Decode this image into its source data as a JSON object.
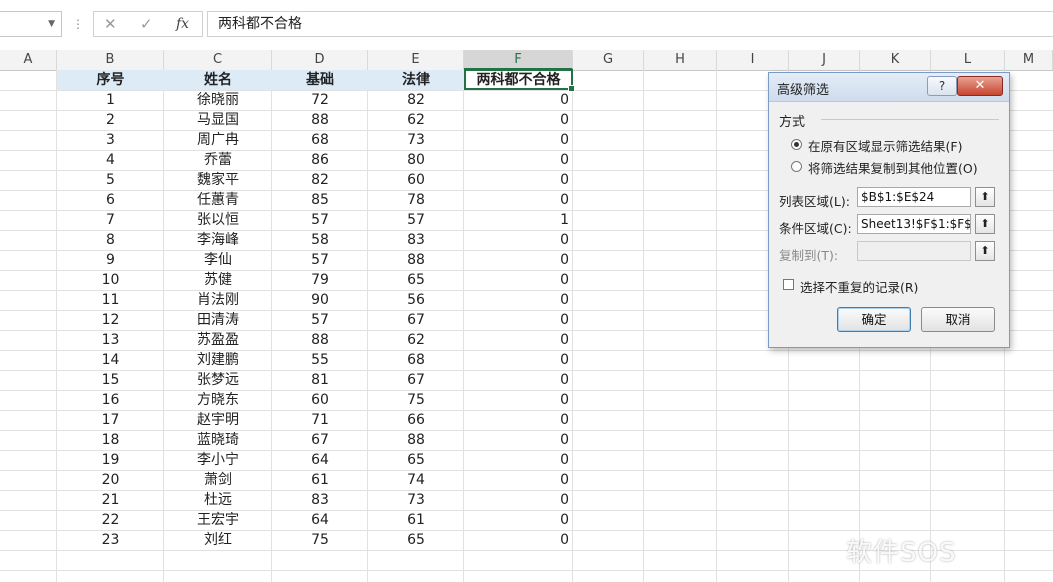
{
  "formula_bar": {
    "name_box": "",
    "cancel_glyph": "✕",
    "enter_glyph": "✓",
    "fx_label": "fx",
    "content": "两科都不合格"
  },
  "columns": [
    "A",
    "B",
    "C",
    "D",
    "E",
    "F",
    "G",
    "H",
    "I",
    "J",
    "K",
    "L",
    "M"
  ],
  "selected_column": "F",
  "table": {
    "headers": [
      "序号",
      "姓名",
      "基础",
      "法律",
      "两科都不合格"
    ],
    "rows": [
      [
        "1",
        "徐晓丽",
        "72",
        "82",
        "0"
      ],
      [
        "2",
        "马显国",
        "88",
        "62",
        "0"
      ],
      [
        "3",
        "周广冉",
        "68",
        "73",
        "0"
      ],
      [
        "4",
        "乔蕾",
        "86",
        "80",
        "0"
      ],
      [
        "5",
        "魏家平",
        "82",
        "60",
        "0"
      ],
      [
        "6",
        "任蕙青",
        "85",
        "78",
        "0"
      ],
      [
        "7",
        "张以恒",
        "57",
        "57",
        "1"
      ],
      [
        "8",
        "李海峰",
        "58",
        "83",
        "0"
      ],
      [
        "9",
        "李仙",
        "57",
        "88",
        "0"
      ],
      [
        "10",
        "苏健",
        "79",
        "65",
        "0"
      ],
      [
        "11",
        "肖法刚",
        "90",
        "56",
        "0"
      ],
      [
        "12",
        "田清涛",
        "57",
        "67",
        "0"
      ],
      [
        "13",
        "苏盈盈",
        "88",
        "62",
        "0"
      ],
      [
        "14",
        "刘建鹏",
        "55",
        "68",
        "0"
      ],
      [
        "15",
        "张梦远",
        "81",
        "67",
        "0"
      ],
      [
        "16",
        "方晓东",
        "60",
        "75",
        "0"
      ],
      [
        "17",
        "赵宇明",
        "71",
        "66",
        "0"
      ],
      [
        "18",
        "蓝晓琦",
        "67",
        "88",
        "0"
      ],
      [
        "19",
        "李小宁",
        "64",
        "65",
        "0"
      ],
      [
        "20",
        "萧剑",
        "61",
        "74",
        "0"
      ],
      [
        "21",
        "杜远",
        "83",
        "73",
        "0"
      ],
      [
        "22",
        "王宏宇",
        "64",
        "61",
        "0"
      ],
      [
        "23",
        "刘红",
        "75",
        "65",
        "0"
      ]
    ]
  },
  "dialog": {
    "title": "高级筛选",
    "help_label": "?",
    "close_label": "✕",
    "section_label": "方式",
    "option_inplace": "在原有区域显示筛选结果(F)",
    "option_copy": "将筛选结果复制到其他位置(O)",
    "list_range_label": "列表区域(L):",
    "list_range_value": "$B$1:$E$24",
    "criteria_range_label": "条件区域(C):",
    "criteria_range_value": "Sheet13!$F$1:$F$2",
    "copy_to_label": "复制到(T):",
    "copy_to_value": "",
    "collapse_glyph": "⬆",
    "unique_label": "选择不重复的记录(R)",
    "ok_label": "确定",
    "cancel_label": "取消"
  },
  "watermark": "软件SOS",
  "colors": {
    "accent": "#217346",
    "header_fill": "#ddebf7"
  }
}
